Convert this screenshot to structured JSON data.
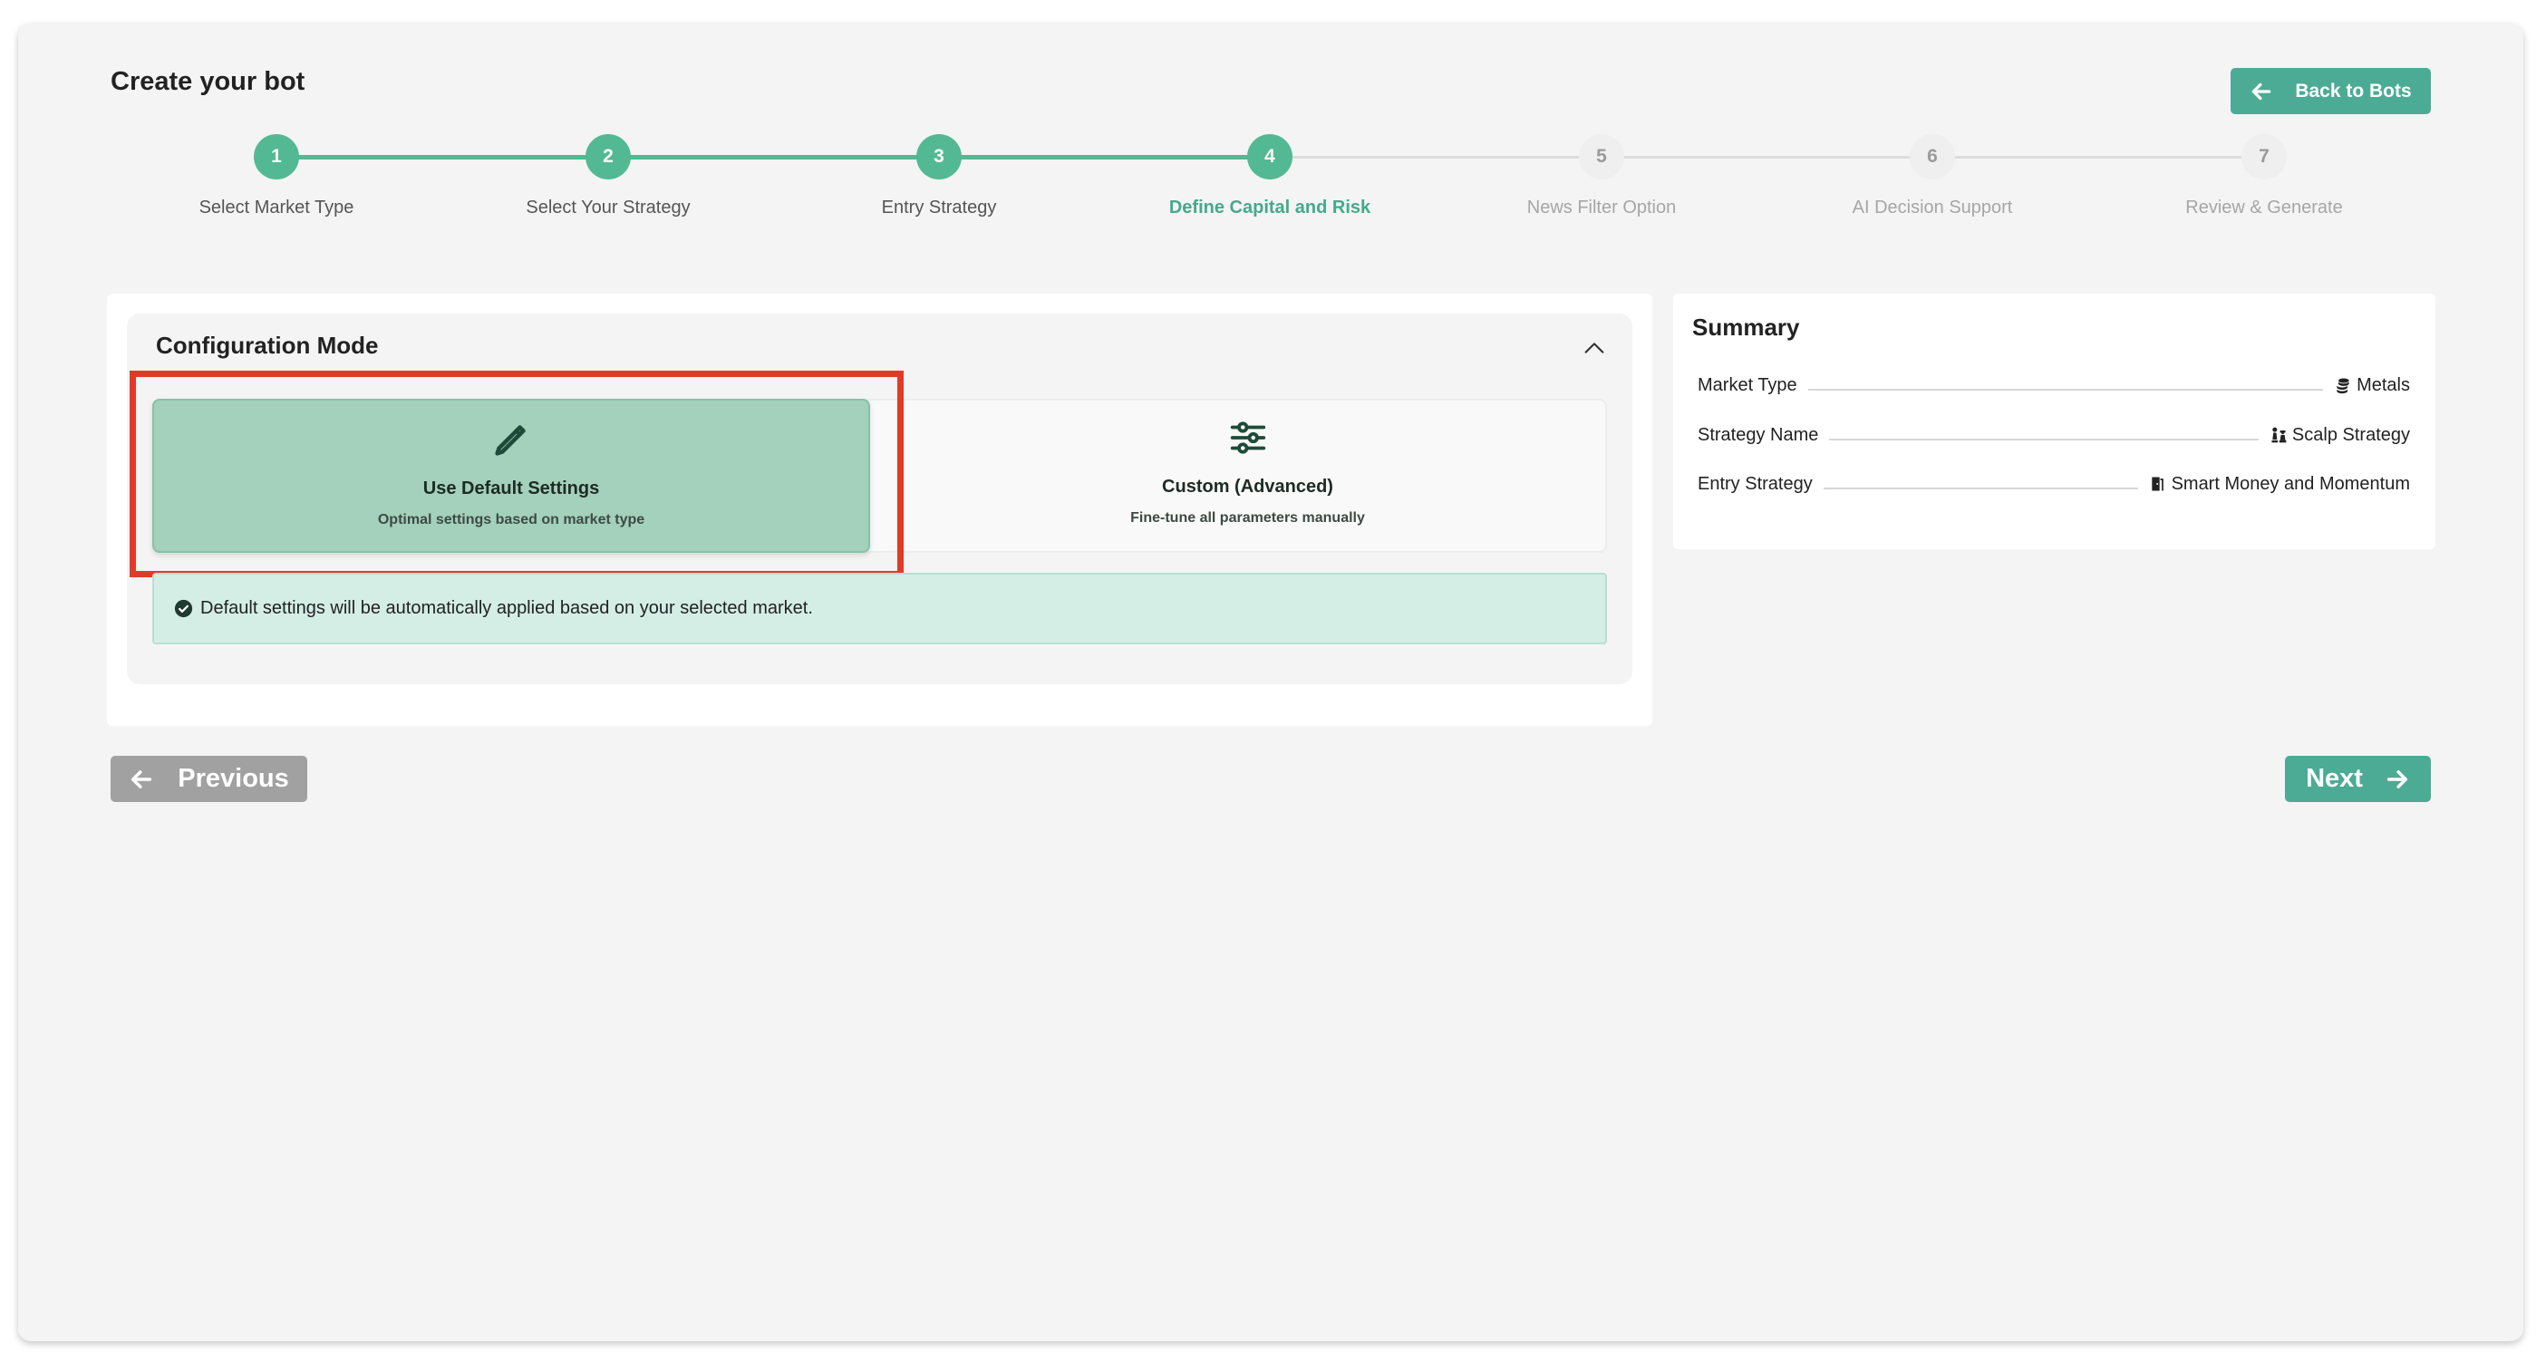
{
  "header": {
    "title": "Create your bot",
    "back_label": "Back to Bots"
  },
  "stepper": {
    "steps": [
      {
        "number": "1",
        "label": "Select Market Type",
        "state": "done"
      },
      {
        "number": "2",
        "label": "Select Your Strategy",
        "state": "done"
      },
      {
        "number": "3",
        "label": "Entry Strategy",
        "state": "done"
      },
      {
        "number": "4",
        "label": "Define Capital and Risk",
        "state": "active"
      },
      {
        "number": "5",
        "label": "News Filter Option",
        "state": "todo"
      },
      {
        "number": "6",
        "label": "AI Decision Support",
        "state": "todo"
      },
      {
        "number": "7",
        "label": "Review & Generate",
        "state": "todo"
      }
    ]
  },
  "config": {
    "title": "Configuration Mode",
    "default_option": {
      "title": "Use Default Settings",
      "subtitle": "Optimal settings based on market type",
      "icon": "pencil-icon",
      "selected": true
    },
    "custom_option": {
      "title": "Custom (Advanced)",
      "subtitle": "Fine-tune all parameters manually",
      "icon": "sliders-icon",
      "selected": false
    },
    "info_text": "Default settings will be automatically applied based on your selected market."
  },
  "summary": {
    "title": "Summary",
    "rows": [
      {
        "label": "Market Type",
        "value": "Metals",
        "icon": "coins-icon"
      },
      {
        "label": "Strategy Name",
        "value": "Scalp Strategy",
        "icon": "chess-icon"
      },
      {
        "label": "Entry Strategy",
        "value": "Smart Money and Momentum",
        "icon": "door-icon"
      }
    ]
  },
  "nav": {
    "previous_label": "Previous",
    "next_label": "Next"
  },
  "colors": {
    "accent": "#4cab95",
    "step_done": "#52b994",
    "selected_card": "#a3d1bb",
    "info_bg": "#d4eee6",
    "highlight": "#e23a28",
    "disabled_button": "#a1a1a1"
  }
}
